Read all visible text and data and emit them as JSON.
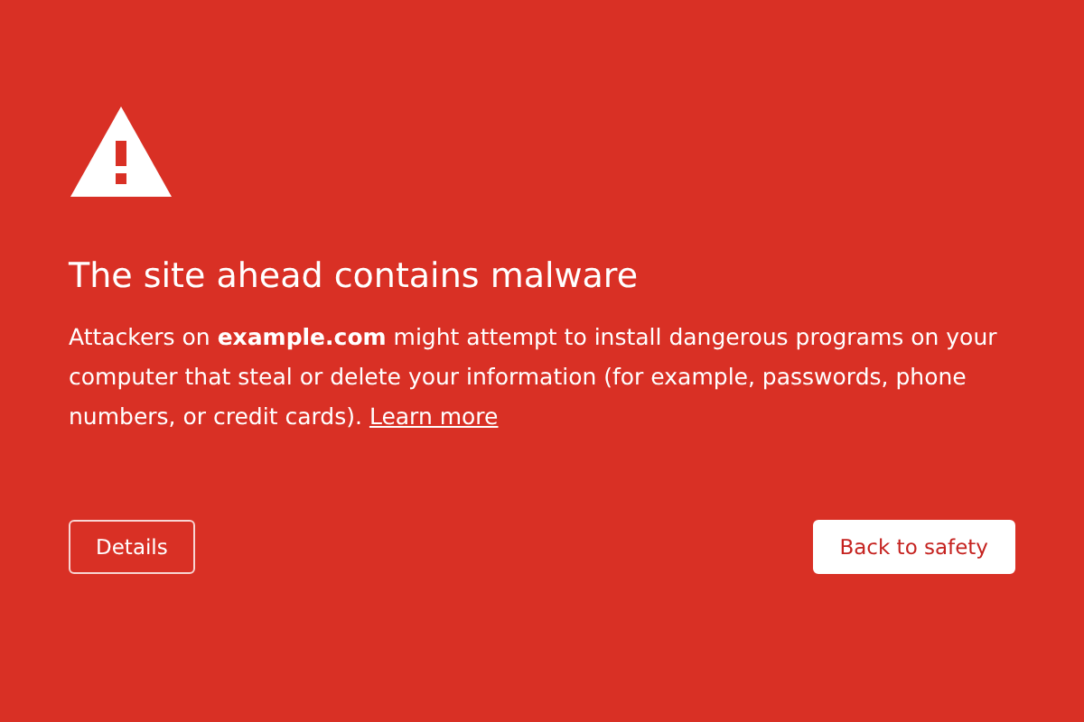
{
  "heading": "The site ahead contains malware",
  "description": "Attackers on **example.com** might attempt to install dangerous programs on your computer that steal or delete your information (for example, passwords, phone numbers, or credit cards).",
  "learn_more": "Learn more",
  "buttons": [
    {
      "label": "Details",
      "kind": "secondary"
    },
    {
      "label": "Back to safety",
      "kind": "primary"
    }
  ]
}
